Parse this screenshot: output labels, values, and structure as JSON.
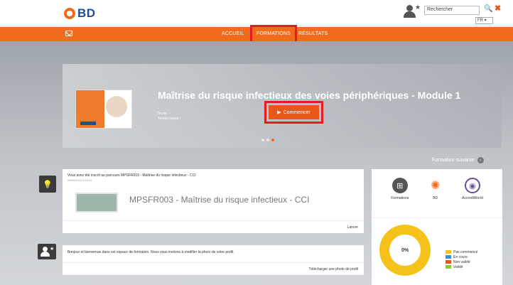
{
  "header": {
    "logo_text": "BD",
    "search_placeholder": "Rechercher",
    "language": "FR ▾",
    "close_label": "✖",
    "search_label": "🔍"
  },
  "nav": {
    "items": [
      "ACCUEIL",
      "FORMATIONS",
      "RÉSULTATS"
    ]
  },
  "banner": {
    "title": "Maîtrise du risque infectieux des voies périphériques - Module 1",
    "dash": "-",
    "score_label": "Score : -",
    "time_label": "Temps passé : -",
    "button_label": "Commencer",
    "slide_count": 3,
    "active_slide": 3
  },
  "next_link": "Formation suivante",
  "activity": {
    "title": "Vous avez été inscrit au parcours MPSFR003 - Maîtrise du risque infectieux - CCI",
    "date": "06/09/2015 à 03:41",
    "course_name": "MPSFR003 - Maîtrise du risque infectieux - CCI",
    "action": "Lancer"
  },
  "welcome": {
    "message": "Bonjour et bienvenue dans cet espace de formation. Nous vous invitons à modifier la photo de votre profil.",
    "action": "Télécharger une photo de profil"
  },
  "apps": [
    {
      "label": "Formations",
      "icon": "grid-icon"
    },
    {
      "label": "BD",
      "icon": "bd-logo-icon"
    },
    {
      "label": "AccrediWorld",
      "icon": "accrediworld-icon"
    }
  ],
  "progress": {
    "percent_label": "0%",
    "legend": [
      {
        "label": "Pas commencé",
        "color": "#f5c21b"
      },
      {
        "label": "En cours",
        "color": "#3b8ed0"
      },
      {
        "label": "Non validé",
        "color": "#e5571a"
      },
      {
        "label": "Validé",
        "color": "#8dc63f"
      }
    ]
  },
  "colors": {
    "brand_orange": "#f26b1d",
    "highlight_red": "#e31c23",
    "brand_blue": "#1f4e97"
  }
}
